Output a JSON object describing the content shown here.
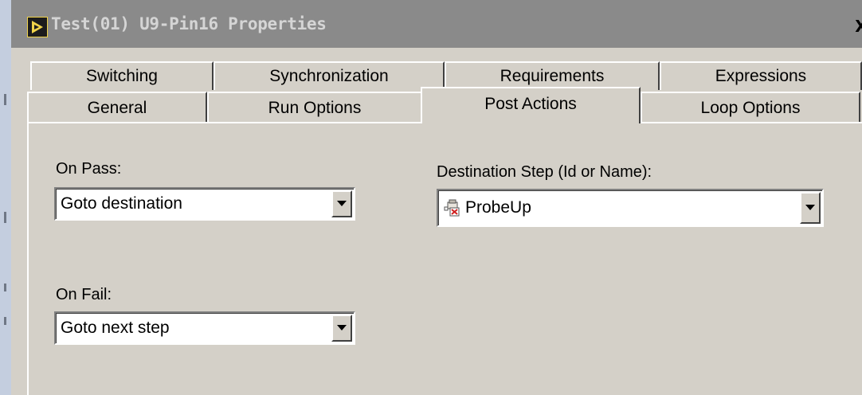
{
  "window": {
    "title": "Test(01) U9-Pin16 Properties",
    "close_label": "X"
  },
  "tabs": {
    "row_top": [
      "Switching",
      "Synchronization",
      "Requirements",
      "Expressions"
    ],
    "row_bottom": [
      "General",
      "Run Options",
      "Post Actions",
      "Loop Options"
    ],
    "active": "Post Actions"
  },
  "post_actions": {
    "on_pass_label": "On Pass:",
    "on_pass_value": "Goto destination",
    "on_fail_label": "On Fail:",
    "on_fail_value": "Goto next step",
    "destination_label": "Destination Step (Id or Name):",
    "destination_value": "ProbeUp",
    "destination_icon": "step-icon"
  },
  "colors": {
    "dialog_face": "#d4d0c8",
    "titlebar_inactive": "#8a8a8a",
    "title_text": "#d5d5d5"
  }
}
